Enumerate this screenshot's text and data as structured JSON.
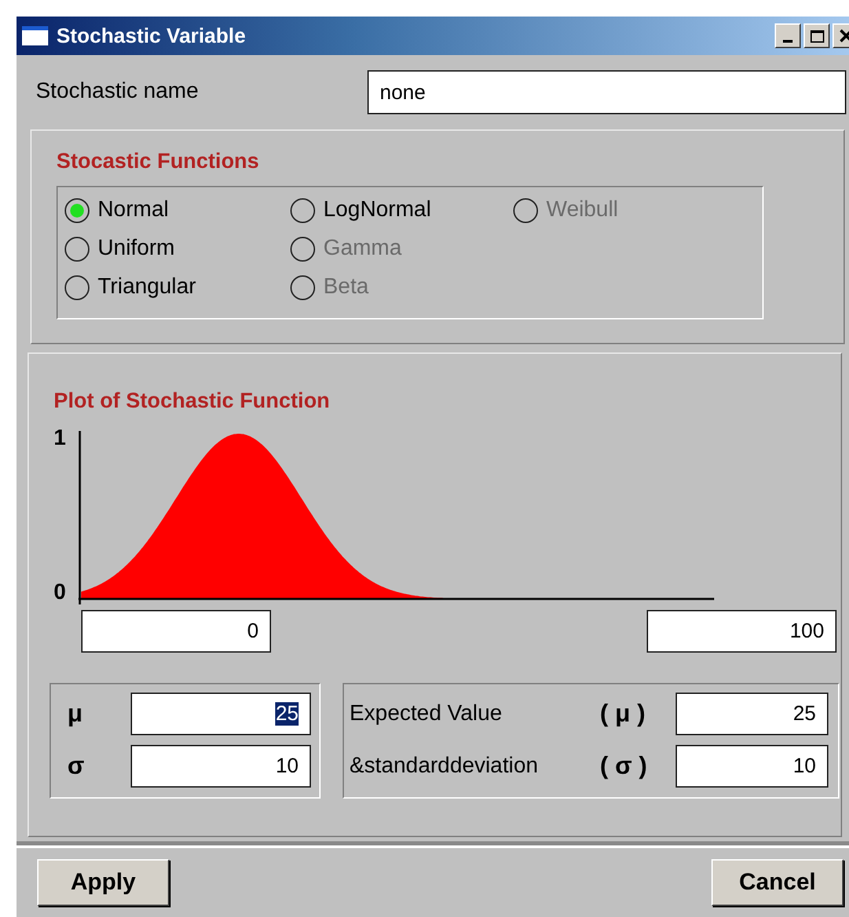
{
  "window": {
    "title": "Stochastic Variable"
  },
  "name_field": {
    "label": "Stochastic name",
    "value": "none"
  },
  "functions": {
    "title": "Stocastic Functions",
    "options": [
      {
        "label": "Normal",
        "selected": true,
        "disabled": false
      },
      {
        "label": "Uniform",
        "selected": false,
        "disabled": false
      },
      {
        "label": "Triangular",
        "selected": false,
        "disabled": false
      },
      {
        "label": "LogNormal",
        "selected": false,
        "disabled": false
      },
      {
        "label": "Gamma",
        "selected": false,
        "disabled": true
      },
      {
        "label": "Beta",
        "selected": false,
        "disabled": true
      },
      {
        "label": "Weibull",
        "selected": false,
        "disabled": true
      }
    ]
  },
  "plot": {
    "title": "Plot of Stochastic Function",
    "y_max_label": "1",
    "y_min_label": "0",
    "x_min": "0",
    "x_max": "100"
  },
  "params": [
    {
      "symbol": "μ",
      "value": "25",
      "selected": true
    },
    {
      "symbol": "σ",
      "value": "10",
      "selected": false
    }
  ],
  "moments": [
    {
      "label": "Expected Value",
      "symbol": "( μ )",
      "value": "25"
    },
    {
      "label": "&standarddeviation",
      "symbol": "( σ )",
      "value": "10"
    }
  ],
  "buttons": [
    "Apply",
    "Cancel"
  ]
}
